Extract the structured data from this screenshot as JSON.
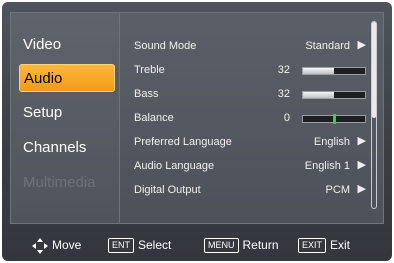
{
  "left_menu": {
    "items": [
      {
        "label": "Video",
        "state": "normal"
      },
      {
        "label": "Audio",
        "state": "active"
      },
      {
        "label": "Setup",
        "state": "normal"
      },
      {
        "label": "Channels",
        "state": "normal"
      },
      {
        "label": "Multimedia",
        "state": "disabled"
      }
    ]
  },
  "settings": {
    "sound_mode": {
      "label": "Sound Mode",
      "value": "Standard",
      "arrow": "▶"
    },
    "treble": {
      "label": "Treble",
      "value": "32",
      "level_fraction": 0.5
    },
    "bass": {
      "label": "Bass",
      "value": "32",
      "level_fraction": 0.5
    },
    "balance": {
      "label": "Balance",
      "value": "0",
      "level_fraction": 0.5
    },
    "preferred_language": {
      "label": "Preferred Language",
      "value": "English",
      "arrow": "▶"
    },
    "audio_language": {
      "label": "Audio Language",
      "value": "English 1",
      "arrow": "▶"
    },
    "digital_output": {
      "label": "Digital Output",
      "value": "PCM",
      "arrow": "▶"
    }
  },
  "bottom_hints": {
    "move": {
      "label": "Move"
    },
    "select": {
      "key": "ENT",
      "label": "Select"
    },
    "return": {
      "key": "MENU",
      "label": "Return"
    },
    "exit": {
      "key": "EXIT",
      "label": "Exit"
    }
  },
  "colors": {
    "active_tab": "#f39a16",
    "balance_marker": "#3cd23c",
    "panel_bg": "#4f535b"
  }
}
